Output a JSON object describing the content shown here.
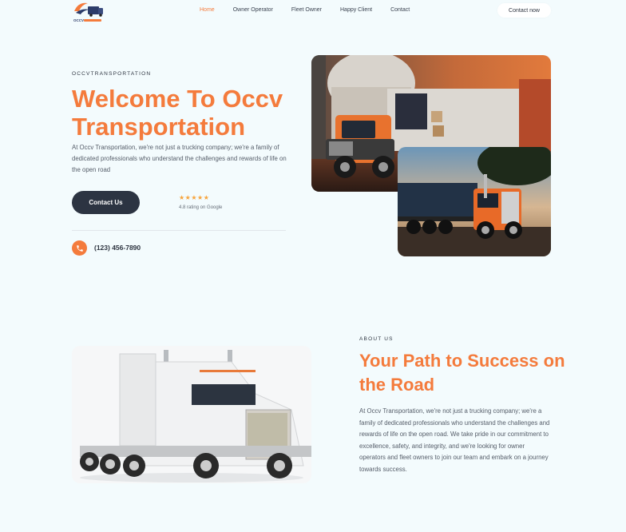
{
  "nav": {
    "logo_text": "OCCV",
    "links": [
      "Home",
      "Owner Operator",
      "Fleet Owner",
      "Happy Client",
      "Contact"
    ],
    "cta": "Contact now"
  },
  "hero": {
    "eyebrow": "OCCVTRANSPORTATION",
    "title": "Welcome To Occv Transportation",
    "description": "At Occv Transportation, we're not just a trucking company; we're a family of dedicated professionals who understand the challenges and rewards of life on the open road",
    "button": "Contact Us",
    "stars": "★★★★★",
    "rating_text": "4.8 rating on Google",
    "phone": "(123) 456-7890"
  },
  "about": {
    "eyebrow": "ABOUT US",
    "title": "Your Path to Success on the Road",
    "description": "At Occv Transportation, we're not just a trucking company; we're a family of dedicated professionals who understand the challenges and rewards of life on the open road. We take pride in our commitment to excellence, safety, and integrity, and we're looking for owner operators and fleet owners to join our team and embark on a journey towards success."
  },
  "colors": {
    "accent": "#f47b3c",
    "dark": "#2c3442",
    "background": "#f3fbfd"
  }
}
